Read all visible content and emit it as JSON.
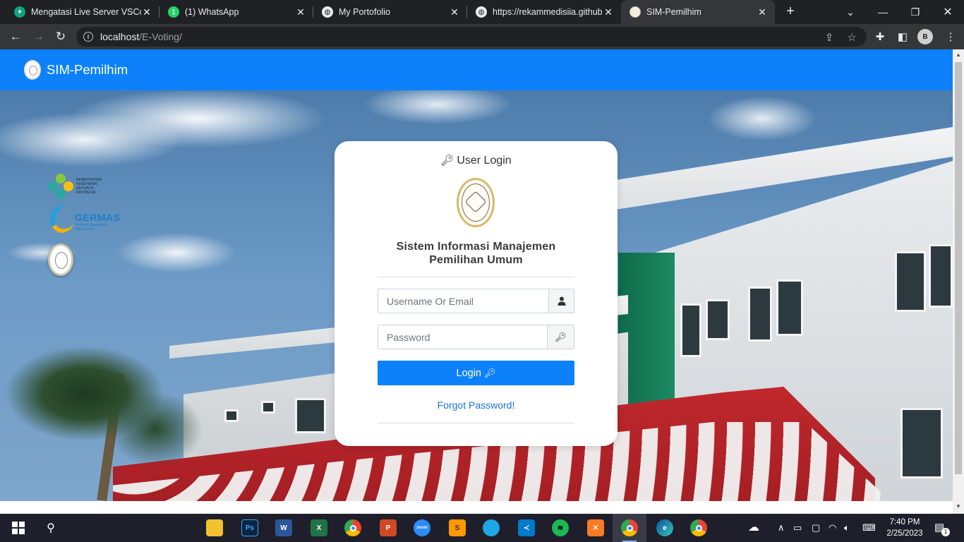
{
  "browser": {
    "tabs": [
      {
        "title": "Mengatasi Live Server VSCode",
        "icon": "chatgpt-icon",
        "active": false
      },
      {
        "title": "(1) WhatsApp",
        "icon": "whatsapp-icon",
        "active": false
      },
      {
        "title": "My Portofolio",
        "icon": "globe-icon",
        "active": false
      },
      {
        "title": "https://rekammedisiia.github.io",
        "icon": "globe-icon",
        "active": false
      },
      {
        "title": "SIM-Pemilhim",
        "icon": "seal-icon",
        "active": true
      }
    ],
    "address": {
      "host": "localhost",
      "path": "/E-Voting/"
    },
    "profile_initial": "B"
  },
  "navbar": {
    "brand": "SIM-Pemilhim"
  },
  "login": {
    "title": "User Login",
    "system_line1": "Sistem Informasi Manajemen",
    "system_line2": "Pemilihan Umum",
    "username_placeholder": "Username Or Email",
    "password_placeholder": "Password",
    "button_label": "Login",
    "forgot_label": "Forgot Password!"
  },
  "sponsors": {
    "kemenkes_text": "KEMENTERIAN KESEHATAN REPUBLIK INDONESIA",
    "germas_text": "GERMAS",
    "germas_sub": "Gerakan Masyarakat Hidup Sehat"
  },
  "taskbar": {
    "apps": [
      "file-explorer",
      "photoshop",
      "word",
      "excel",
      "chrome",
      "powerpoint",
      "zoom",
      "sublime-text",
      "app",
      "vscode",
      "spotify",
      "xampp",
      "chrome",
      "edge",
      "chrome"
    ],
    "zoom_label": "zoom",
    "time": "7:40 PM",
    "date": "2/25/2023",
    "notification_count": "1"
  },
  "colors": {
    "primary": "#0d81fc",
    "link": "#1a73d9"
  }
}
